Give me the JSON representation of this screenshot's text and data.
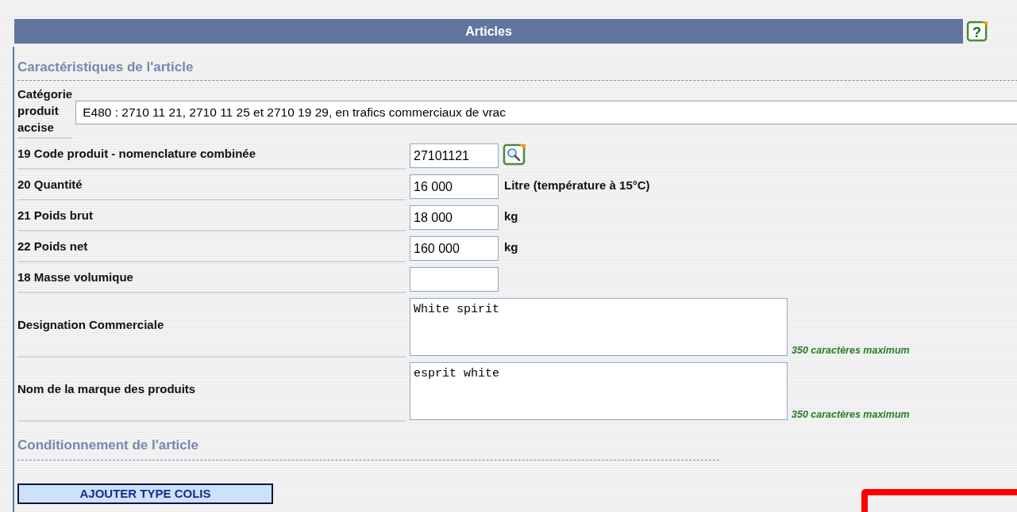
{
  "header": {
    "title": "Articles",
    "help": "?"
  },
  "characteristics": {
    "title": "Caractéristiques de l'article",
    "category": {
      "label": "Catégorie produit accise",
      "value": "E480 : 2710 11 21, 2710 11 25 et 2710 19 29, en trafics commerciaux de vrac"
    },
    "fields": [
      {
        "kind": "input",
        "label": "19 Code produit - nomenclature combinée",
        "value": "27101121",
        "lookup": true
      },
      {
        "kind": "input",
        "label": "20 Quantité",
        "value": "16 000",
        "unit": "Litre (température à 15°C)",
        "lookup": false
      },
      {
        "kind": "input",
        "label": "21 Poids brut",
        "value": "18 000",
        "unit": "kg",
        "lookup": false
      },
      {
        "kind": "input",
        "label": "22 Poids net",
        "value": "160 000",
        "unit": "kg",
        "lookup": false
      },
      {
        "kind": "input",
        "label": "18 Masse volumique",
        "lookup": false
      },
      {
        "kind": "textarea",
        "label": "Designation Commerciale",
        "value": "White spirit",
        "hint": "350 caractères maximum"
      },
      {
        "kind": "textarea",
        "label": "Nom de la marque des produits",
        "value": "esprit white",
        "hint": "350 caractères maximum"
      }
    ]
  },
  "packaging": {
    "title": "Conditionnement de l'article",
    "add_button": "AJOUTER TYPE COLIS"
  }
}
